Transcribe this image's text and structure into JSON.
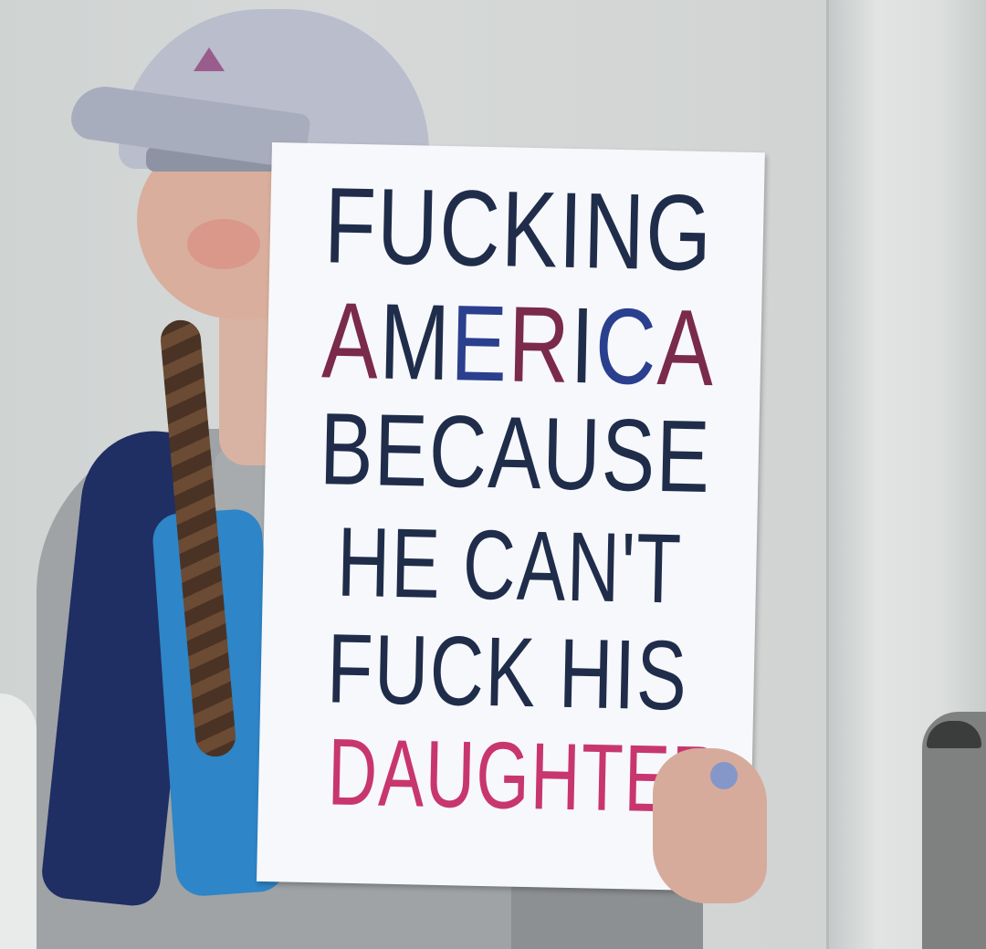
{
  "sign": {
    "line1": "FUCKING",
    "line2": "AMERICA",
    "line3": "BECAUSE",
    "line4": "HE CAN'T",
    "line5": "FUCK HIS",
    "line6": "DAUGHTER"
  },
  "colors": {
    "ink_navy": "#1f2d4a",
    "ink_red": "#7a2a4a",
    "ink_blue": "#2b3f8f",
    "ink_pink": "#c8366f",
    "sign_paper": "#f7f8fb",
    "wall": "#d3d6d6"
  }
}
